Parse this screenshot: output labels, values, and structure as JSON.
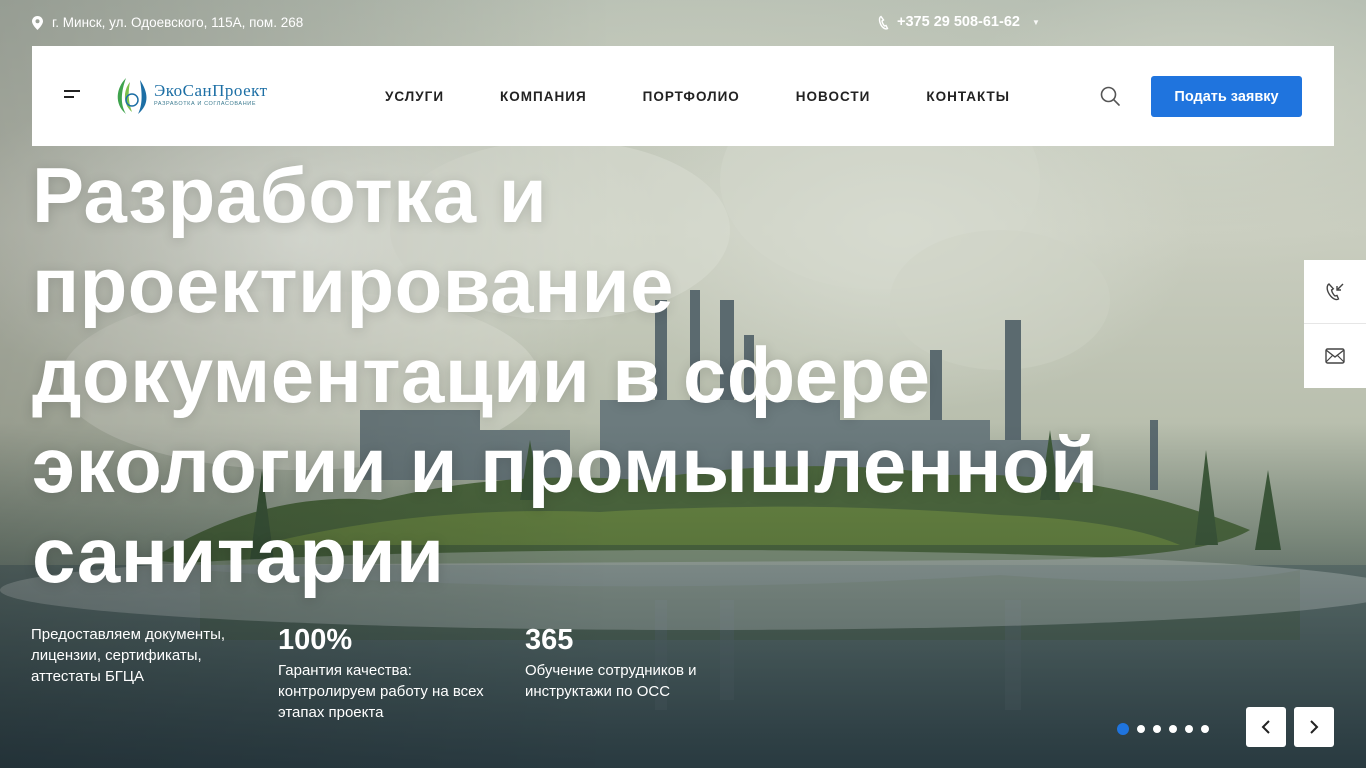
{
  "topbar": {
    "address": "г. Минск, ул. Одоевского, 115А, пом. 268",
    "phone": "+375 29 508-61-62"
  },
  "logo": {
    "name": "ЭкоСанПроект",
    "tagline": "Разработка и согласование"
  },
  "nav": {
    "items": [
      {
        "label": "УСЛУГИ"
      },
      {
        "label": "КОМПАНИЯ"
      },
      {
        "label": "ПОРТФОЛИО"
      },
      {
        "label": "НОВОСТИ"
      },
      {
        "label": "КОНТАКТЫ"
      }
    ]
  },
  "header": {
    "cta_label": "Подать заявку"
  },
  "hero": {
    "title": "Разработка и проектирование документации в сфере экологии и промышленной санитарии",
    "stats": [
      {
        "number": "",
        "text": "Предоставляем документы, лицензии, сертификаты, аттестаты БГЦА"
      },
      {
        "number": "100%",
        "text": "Гарантия качества: контролируем работу на всех этапах проекта"
      },
      {
        "number": "365",
        "text": "Обучение сотрудников и инструктажи по ОСС"
      }
    ]
  },
  "slider": {
    "slide_count": 6,
    "active_index": 0
  },
  "colors": {
    "accent": "#1f74de",
    "nav_text": "#222222",
    "hero_text": "#ffffff"
  },
  "icons": {
    "address": "map-pin-icon",
    "phone": "phone-icon",
    "search": "search-icon",
    "menu": "hamburger-menu-icon",
    "callback": "phone-callback-icon",
    "mail": "envelope-icon",
    "prev": "chevron-left-icon",
    "next": "chevron-right-icon"
  }
}
